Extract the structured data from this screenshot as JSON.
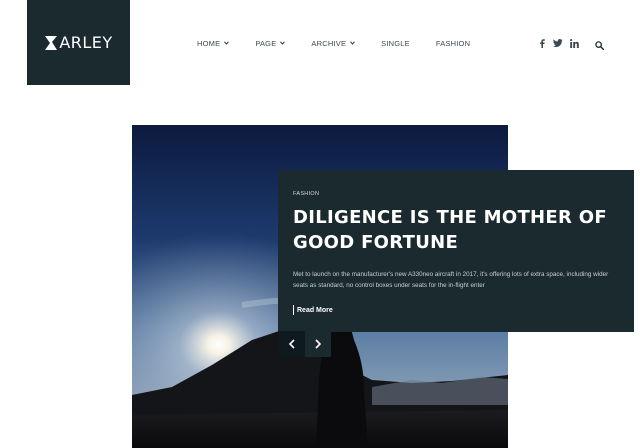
{
  "brand": {
    "logo_text": "ARLEY"
  },
  "nav": {
    "items": [
      {
        "label": "HOME",
        "dropdown": true
      },
      {
        "label": "PAGE",
        "dropdown": true
      },
      {
        "label": "ARCHIVE",
        "dropdown": true
      },
      {
        "label": "SINGLE",
        "dropdown": false
      },
      {
        "label": "FASHION",
        "dropdown": false
      }
    ]
  },
  "social": [
    "facebook-icon",
    "twitter-icon",
    "linkedin-icon"
  ],
  "featured": {
    "category": "FASHION",
    "title": "DILIGENCE IS THE MOTHER OF GOOD FORTUNE",
    "excerpt": "Met to launch on the manufacturer's new A330neo aircraft in 2017, it's offering lots of extra space, including wider seats as standard, no control boxes under seats for the in-flight enter",
    "read_more": "Read More"
  },
  "colors": {
    "dark": "#1b2a2f",
    "background": "#ffffff",
    "text_muted": "#c8d0d2"
  }
}
